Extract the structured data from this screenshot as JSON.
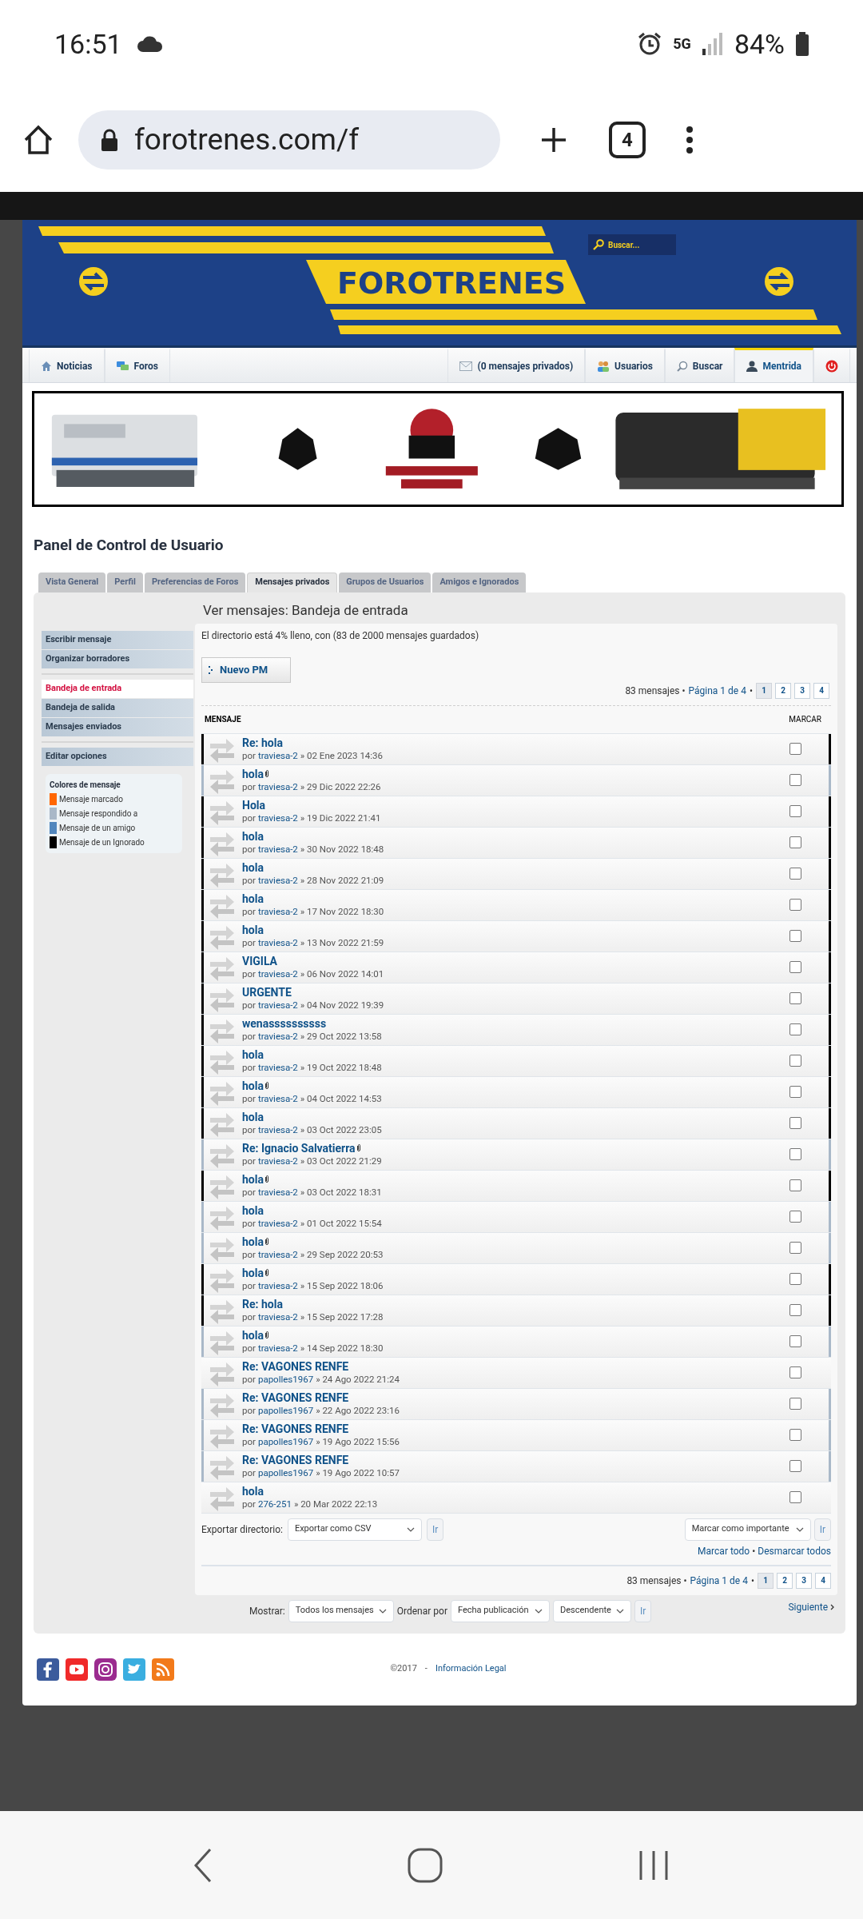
{
  "status_bar": {
    "time": "16:51",
    "network": "5G",
    "battery": "84%"
  },
  "browser": {
    "url": "forotrenes.com/f",
    "tab_count": "4"
  },
  "site_header": {
    "logo": "FOROTRENES",
    "search_placeholder": "Buscar..."
  },
  "nav": {
    "left": [
      {
        "kind": "house",
        "label": "Noticias",
        "selected": false
      },
      {
        "kind": "chat",
        "label": "Foros",
        "selected": false
      }
    ],
    "right": [
      {
        "kind": "mail",
        "label": "(0 mensajes privados)",
        "selected": false
      },
      {
        "kind": "users",
        "label": "Usuarios",
        "selected": false
      },
      {
        "kind": "search",
        "label": "Buscar",
        "selected": false
      },
      {
        "kind": "user",
        "label": "Mentrida",
        "selected": true
      },
      {
        "kind": "power",
        "selected": false
      }
    ]
  },
  "panel": {
    "title": "Panel de Control de Usuario"
  },
  "tabs": [
    {
      "label": "Vista General",
      "selected": false
    },
    {
      "label": "Perfil",
      "selected": false
    },
    {
      "label": "Preferencias de Foros",
      "selected": false
    },
    {
      "label": "Mensajes privados",
      "selected": true
    },
    {
      "label": "Grupos de Usuarios",
      "selected": false
    },
    {
      "label": "Amigos e Ignorados",
      "selected": false
    }
  ],
  "sidebar": {
    "groups": [
      [
        {
          "label": "Escribir mensaje",
          "selected": false
        },
        {
          "label": "Organizar borradores",
          "selected": false
        }
      ],
      [
        {
          "label": "Bandeja de entrada",
          "selected": true
        },
        {
          "label": "Bandeja de salida",
          "selected": false
        },
        {
          "label": "Mensajes enviados",
          "selected": false
        }
      ],
      [
        {
          "label": "Editar opciones",
          "selected": false
        }
      ]
    ]
  },
  "legend": {
    "title": "Colores de mensaje",
    "items": [
      {
        "label": "Mensaje marcado",
        "color": "#ff6600"
      },
      {
        "label": "Mensaje respondido a",
        "color": "#a9b8c8"
      },
      {
        "label": "Mensaje de un amigo",
        "color": "#5186bd"
      },
      {
        "label": "Mensaje de un Ignorado",
        "color": "#000000"
      }
    ]
  },
  "inbox": {
    "heading": "Ver mensajes: Bandeja de entrada",
    "usage": "El directorio está 4% lleno, con (83 de 2000 mensajes guardados)",
    "new_button": "Nuevo PM",
    "pagination_top": {
      "count": "83 mensajes •",
      "page": "Página 1 de 4",
      "dot": "•",
      "pages": [
        {
          "label": "1",
          "selected": true
        },
        {
          "label": "2",
          "selected": false
        },
        {
          "label": "3",
          "selected": false
        },
        {
          "label": "4",
          "selected": false
        }
      ]
    },
    "columns": [
      "MENSAJE",
      "MARCAR"
    ],
    "rows": [
      {
        "title": "Re: hola",
        "attachment": false,
        "by": "por",
        "author": "traviesa-2",
        "date": "» 02 Ene 2023 14:36",
        "checked": false,
        "color": "#000000"
      },
      {
        "title": "hola",
        "attachment": true,
        "by": "por",
        "author": "traviesa-2",
        "date": "» 29 Dic 2022 22:26",
        "checked": false,
        "color": "#a9b8c8"
      },
      {
        "title": "Hola",
        "attachment": false,
        "by": "por",
        "author": "traviesa-2",
        "date": "» 19 Dic 2022 21:41",
        "checked": false,
        "color": "#000000"
      },
      {
        "title": "hola",
        "attachment": false,
        "by": "por",
        "author": "traviesa-2",
        "date": "» 30 Nov 2022 18:48",
        "checked": false,
        "color": "#000000"
      },
      {
        "title": "hola",
        "attachment": false,
        "by": "por",
        "author": "traviesa-2",
        "date": "» 28 Nov 2022 21:09",
        "checked": false,
        "color": "#000000"
      },
      {
        "title": "hola",
        "attachment": false,
        "by": "por",
        "author": "traviesa-2",
        "date": "» 17 Nov 2022 18:30",
        "checked": false,
        "color": "#000000"
      },
      {
        "title": "hola",
        "attachment": false,
        "by": "por",
        "author": "traviesa-2",
        "date": "» 13 Nov 2022 21:59",
        "checked": false,
        "color": "#000000"
      },
      {
        "title": "VIGILA",
        "attachment": false,
        "by": "por",
        "author": "traviesa-2",
        "date": "» 06 Nov 2022 14:01",
        "checked": false,
        "color": "#000000"
      },
      {
        "title": "URGENTE",
        "attachment": false,
        "by": "por",
        "author": "traviesa-2",
        "date": "» 04 Nov 2022 19:39",
        "checked": false,
        "color": "#000000"
      },
      {
        "title": "wenassssssssss",
        "attachment": false,
        "by": "por",
        "author": "traviesa-2",
        "date": "» 29 Oct 2022 13:58",
        "checked": false,
        "color": "#000000"
      },
      {
        "title": "hola",
        "attachment": false,
        "by": "por",
        "author": "traviesa-2",
        "date": "» 19 Oct 2022 18:48",
        "checked": false,
        "color": "#000000"
      },
      {
        "title": "hola",
        "attachment": true,
        "by": "por",
        "author": "traviesa-2",
        "date": "» 04 Oct 2022 14:53",
        "checked": false,
        "color": "#000000"
      },
      {
        "title": "hola",
        "attachment": false,
        "by": "por",
        "author": "traviesa-2",
        "date": "» 03 Oct 2022 23:05",
        "checked": false,
        "color": "#000000"
      },
      {
        "title": "Re: Ignacio Salvatierra",
        "attachment": true,
        "by": "por",
        "author": "traviesa-2",
        "date": "» 03 Oct 2022 21:29",
        "checked": false,
        "color": "#a9b8c8"
      },
      {
        "title": "hola",
        "attachment": true,
        "by": "por",
        "author": "traviesa-2",
        "date": "» 03 Oct 2022 18:31",
        "checked": false,
        "color": "#000000"
      },
      {
        "title": "hola",
        "attachment": false,
        "by": "por",
        "author": "traviesa-2",
        "date": "» 01 Oct 2022 15:54",
        "checked": false,
        "color": "#a9b8c8"
      },
      {
        "title": "hola",
        "attachment": true,
        "by": "por",
        "author": "traviesa-2",
        "date": "» 29 Sep 2022 20:53",
        "checked": false,
        "color": "#a9b8c8"
      },
      {
        "title": "hola",
        "attachment": true,
        "by": "por",
        "author": "traviesa-2",
        "date": "» 15 Sep 2022 18:06",
        "checked": false,
        "color": "#000000"
      },
      {
        "title": "Re: hola",
        "attachment": false,
        "by": "por",
        "author": "traviesa-2",
        "date": "» 15 Sep 2022 17:28",
        "checked": false,
        "color": "#000000"
      },
      {
        "title": "hola",
        "attachment": true,
        "by": "por",
        "author": "traviesa-2",
        "date": "» 14 Sep 2022 18:30",
        "checked": false,
        "color": "#a9b8c8"
      },
      {
        "title": "Re: VAGONES RENFE",
        "attachment": false,
        "by": "por",
        "author": "papolles1967",
        "date": "» 24 Ago 2022 21:24",
        "checked": false
      },
      {
        "title": "Re: VAGONES RENFE",
        "attachment": false,
        "by": "por",
        "author": "papolles1967",
        "date": "» 22 Ago 2022 23:16",
        "checked": false,
        "color": "#a9b8c8"
      },
      {
        "title": "Re: VAGONES RENFE",
        "attachment": false,
        "by": "por",
        "author": "papolles1967",
        "date": "» 19 Ago 2022 15:56",
        "checked": false,
        "color": "#a9b8c8"
      },
      {
        "title": "Re: VAGONES RENFE",
        "attachment": false,
        "by": "por",
        "author": "papolles1967",
        "date": "» 19 Ago 2022 10:57",
        "checked": false,
        "color": "#a9b8c8"
      },
      {
        "title": "hola",
        "attachment": false,
        "by": "por",
        "author": "276-251",
        "date": "» 20 Mar 2022 22:13",
        "checked": false
      }
    ],
    "export": {
      "label": "Exportar directorio:",
      "select": "Exportar como CSV",
      "go": "Ir"
    },
    "mark": {
      "select": "Marcar como importante",
      "go": "Ir",
      "mark_all": "Marcar todo",
      "dot": "•",
      "unmark_all": "Desmarcar todos"
    },
    "pagination_bottom": {
      "count": "83 mensajes •",
      "page": "Página 1 de 4",
      "dot": "•",
      "pages": [
        {
          "label": "1",
          "selected": true
        },
        {
          "label": "2",
          "selected": false
        },
        {
          "label": "3",
          "selected": false
        },
        {
          "label": "4",
          "selected": false
        }
      ]
    }
  },
  "filters": {
    "show_label": "Mostrar:",
    "show": "Todos los mensajes",
    "sort_label": "Ordenar por",
    "sort": "Fecha publicación",
    "order": "Descendente",
    "go": "Ir",
    "next": "Siguiente"
  },
  "footer": {
    "copyright": "©2017",
    "separator": "-",
    "legal": "Información Legal"
  }
}
